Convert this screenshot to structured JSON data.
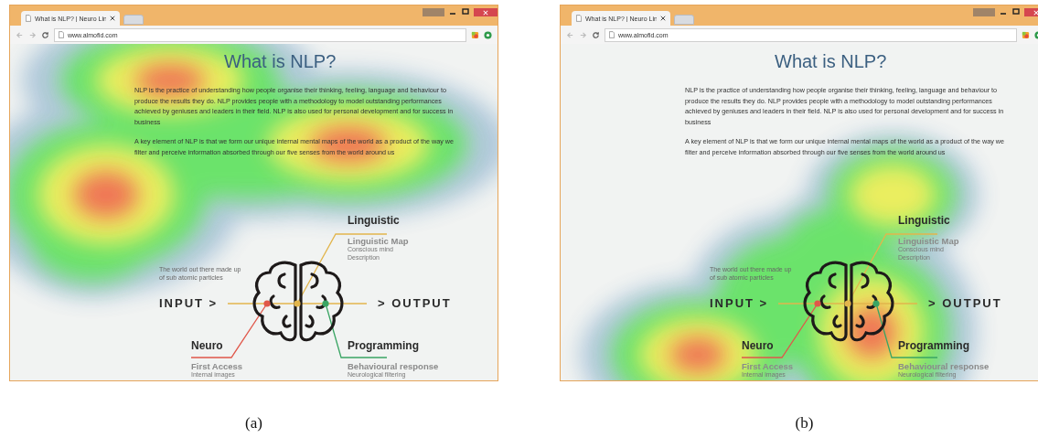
{
  "panels": [
    {
      "caption": "(a)",
      "tab": {
        "title": "What is NLP? | Neuro Lin"
      },
      "address": "www.almofid.com",
      "heading": "What is NLP?",
      "paragraphs": [
        "NLP is the practice of understanding how people organise their thinking, feeling, language and behaviour to produce the results they do. NLP provides people with a methodology to model outstanding performances achieved by geniuses and leaders in their field. NLP is also used for personal development and for success in business",
        "A key element of NLP is that we form our unique internal mental maps of the world as a product of the way we filter and perceive information absorbed through our five senses from the world around us"
      ],
      "diagram": {
        "note": "The world out there made up of sub atomic particles",
        "input": "INPUT >",
        "output": "> OUTPUT",
        "branches": [
          {
            "title": "Linguistic",
            "subtitle": "Linguistic Map",
            "details": [
              "Conscious mind",
              "Description"
            ],
            "color": "#e2b54c"
          },
          {
            "title": "Neuro",
            "subtitle": "First Access",
            "details": [
              "Internal images"
            ],
            "color": "#e0574a"
          },
          {
            "title": "Programming",
            "subtitle": "Behavioural response",
            "details": [
              "Neurological filtering"
            ],
            "color": "#3aa564"
          }
        ]
      }
    },
    {
      "caption": "(b)",
      "tab": {
        "title": "What is NLP? | Neuro Lin"
      },
      "address": "www.almofid.com",
      "heading": "What is NLP?",
      "paragraphs": [
        "NLP is the practice of understanding how people organise their thinking, feeling, language and behaviour to produce the results they do. NLP provides people with a methodology to model outstanding performances achieved by geniuses and leaders in their field. NLP is also used for personal development and for success in business",
        "A key element of NLP is that we form our unique internal mental maps of the world as a product of the way we filter and perceive information absorbed through our five senses from the world around us"
      ],
      "diagram": {
        "note": "The world out there made up of sub atomic particles",
        "input": "INPUT >",
        "output": "> OUTPUT",
        "branches": [
          {
            "title": "Linguistic",
            "subtitle": "Linguistic Map",
            "details": [
              "Conscious mind",
              "Description"
            ],
            "color": "#e2b54c"
          },
          {
            "title": "Neuro",
            "subtitle": "First Access",
            "details": [
              "Internal images"
            ],
            "color": "#e0574a"
          },
          {
            "title": "Programming",
            "subtitle": "Behavioural response",
            "details": [
              "Neurological filtering"
            ],
            "color": "#3aa564"
          }
        ]
      }
    }
  ]
}
